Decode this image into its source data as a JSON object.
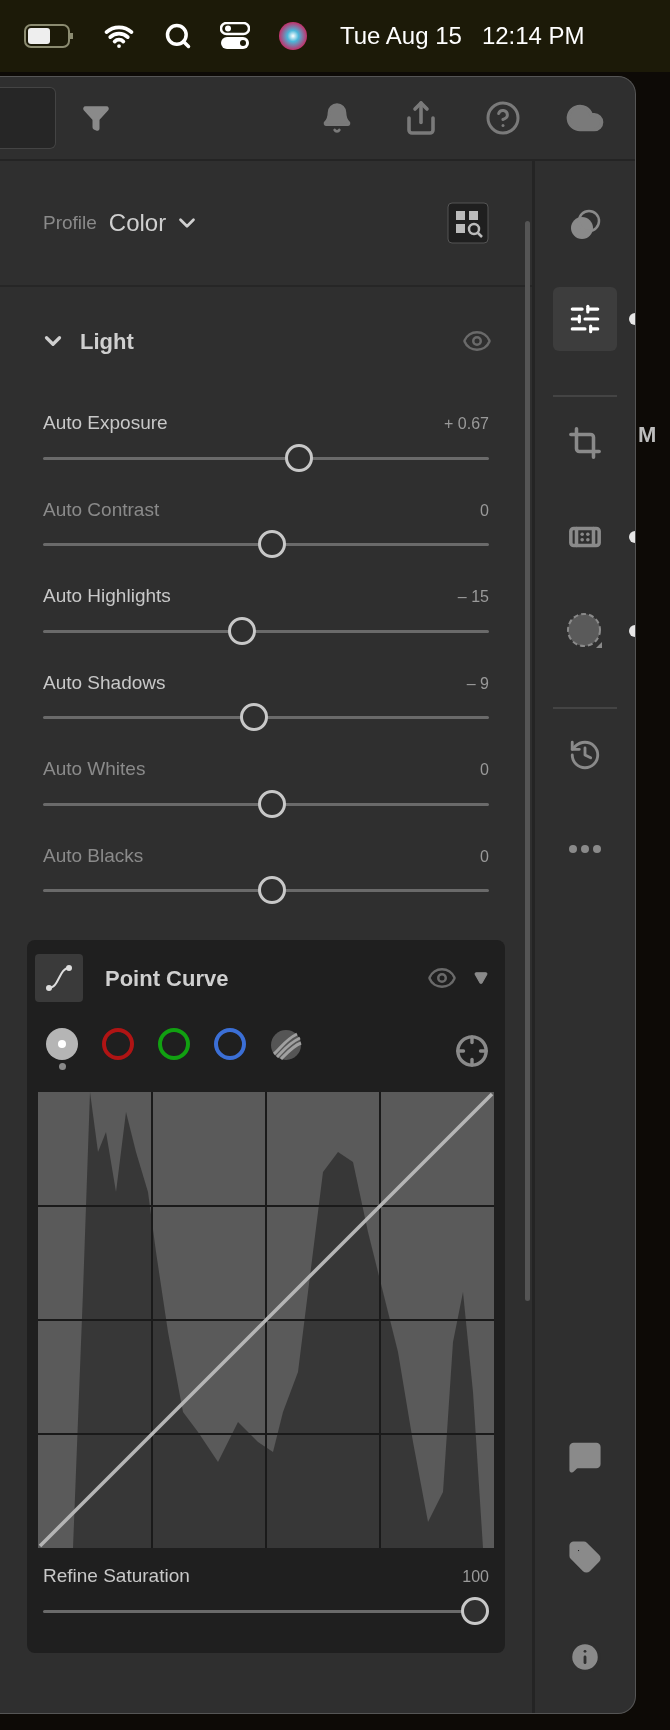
{
  "menu_bar": {
    "date": "Tue Aug 15",
    "time": "12:14 PM"
  },
  "profile": {
    "label": "Profile",
    "value": "Color"
  },
  "light": {
    "title": "Light",
    "expanded": true,
    "sliders": [
      {
        "label": "Auto Exposure",
        "value": "+ 0.67",
        "adjusted": true,
        "level": 0.578
      },
      {
        "label": "Auto Contrast",
        "value": "0",
        "adjusted": false,
        "level": 0.514
      },
      {
        "label": "Auto Highlights",
        "value": "– 15",
        "adjusted": true,
        "level": 0.442
      },
      {
        "label": "Auto Shadows",
        "value": "– 9",
        "adjusted": true,
        "level": 0.472
      },
      {
        "label": "Auto Whites",
        "value": "0",
        "adjusted": false,
        "level": 0.514
      },
      {
        "label": "Auto Blacks",
        "value": "0",
        "adjusted": false,
        "level": 0.514
      }
    ]
  },
  "point_curve": {
    "title": "Point Curve",
    "channels": [
      {
        "kind": "rgb",
        "selected": true
      },
      {
        "kind": "ring",
        "color": "#b01414",
        "selected": false
      },
      {
        "kind": "ring",
        "color": "#11a011",
        "selected": false
      },
      {
        "kind": "ring",
        "color": "#3b6fd6",
        "selected": false
      },
      {
        "kind": "luma",
        "selected": false
      }
    ],
    "refine": {
      "label": "Refine Saturation",
      "value": "100",
      "level": 1.0
    }
  },
  "rail": [
    {
      "kind": "presets",
      "selected": false,
      "dot": false
    },
    {
      "kind": "edit",
      "selected": true,
      "dot": true
    },
    {
      "kind": "divider"
    },
    {
      "kind": "crop",
      "selected": false,
      "dot": false
    },
    {
      "kind": "heal",
      "selected": false,
      "dot": true
    },
    {
      "kind": "mask",
      "selected": false,
      "dot": true
    },
    {
      "kind": "divider"
    },
    {
      "kind": "history",
      "selected": false,
      "dot": false
    },
    {
      "kind": "more",
      "selected": false,
      "dot": false
    }
  ],
  "rail_bottom": [
    {
      "kind": "comment"
    },
    {
      "kind": "tag"
    },
    {
      "kind": "info"
    }
  ],
  "background_text": "M"
}
